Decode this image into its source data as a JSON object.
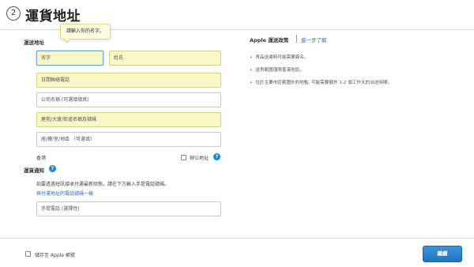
{
  "header": {
    "step_number": "2",
    "title": "運貨地址"
  },
  "tooltip": {
    "text": "請輸入你的名字。"
  },
  "shipping_address": {
    "section_label": "運送地址",
    "fields": {
      "first_name": "名字",
      "last_name": "姓氏",
      "daytime_phone": "日間聯絡電話",
      "company": "公司名稱 (可選填填寫)",
      "street": "屋苑/大廈/街道名稱及號碼",
      "unit": "座/樓/室/地區 （可選填）"
    },
    "region_text": "香港",
    "office_address_label": "辦公地址"
  },
  "shipping_notice": {
    "section_label": "運貨通知",
    "description": "如要透過短訊接收付運最新狀態，請在下方輸入手提電話號碼。",
    "same_as_phone_link": "與付運地址的電話號碼一樣",
    "mobile_placeholder": "手提電話 (選擇性)"
  },
  "policy": {
    "title": "Apple 運送政策",
    "more_link": "進一步了解",
    "items": [
      "貨品送達時可能需要簽名。",
      "送貨範圍僅限香港地區。",
      "位於主要市區範圍外的地點, 可能需要額外 1-2 個工作天的派送時間。"
    ]
  },
  "footer": {
    "save_label": "儲存至 Apple 帳號",
    "continue_label": "繼續"
  },
  "colors": {
    "accent": "#1f74c2",
    "required_field": "#fbf6c5",
    "link": "#2a6ebb",
    "help_icon": "#1e86d6"
  },
  "icons": {
    "help": "question-mark-circle-icon",
    "step": "numbered-circle-icon"
  }
}
